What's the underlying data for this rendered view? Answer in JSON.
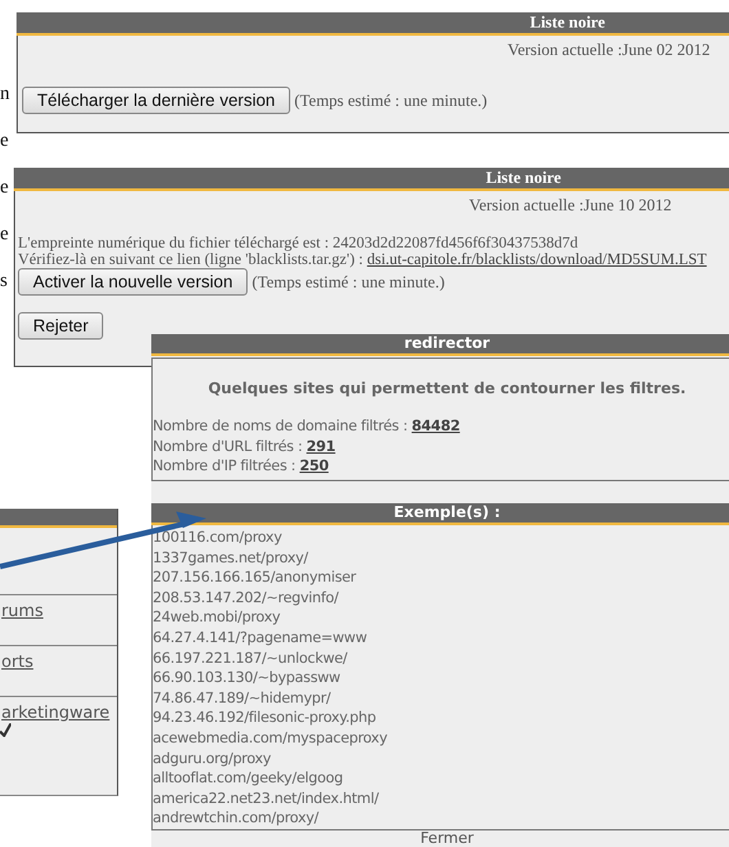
{
  "background_letters": [
    "n",
    "e",
    "e",
    "e",
    "s"
  ],
  "blacklist_current": {
    "title": "Liste noire",
    "version": "Version actuelle :June 02 2012",
    "button": "Télécharger la dernière version",
    "note": "(Temps estimé : une minute.)"
  },
  "blacklist_update": {
    "title": "Liste noire",
    "version": "Version actuelle :June 10 2012",
    "checksum": "L'empreinte numérique du fichier téléchargé est : 24203d2d22087fd456f6f30437538d7d",
    "verify_text": "Vérifiez-là en suivant ce lien (ligne 'blacklists.tar.gz') : ",
    "verify_link": "dsi.ut-capitole.fr/blacklists/download/MD5SUM.LST",
    "activate_button": "Activer la nouvelle version",
    "note": "(Temps estimé : une minute.)",
    "reject_button": "Rejeter"
  },
  "redirector": {
    "title": "redirector",
    "heading": "Quelques sites qui permettent de contourner les filtres.",
    "stats": [
      {
        "label": "Nombre de noms de domaine filtrés : ",
        "value": "84482"
      },
      {
        "label": "Nombre d'URL filtrés : ",
        "value": "291"
      },
      {
        "label": "Nombre d'IP filtrées : ",
        "value": "250"
      }
    ],
    "examples_title": "Exemple(s) :",
    "examples": [
      "100116.com/proxy",
      "1337games.net/proxy/",
      "207.156.166.165/anonymiser",
      "208.53.147.202/~regvinfo/",
      "24web.mobi/proxy",
      "64.27.4.141/?pagename=www",
      "66.197.221.187/~unlockwe/",
      "66.90.103.130/~bypassww",
      "74.86.47.189/~hidemypr/",
      "94.23.46.192/filesonic-proxy.php",
      "acewebmedia.com/myspaceproxy",
      "adguru.org/proxy",
      "alltooflat.com/geeky/elgoog",
      "america22.net23.net/index.html/",
      "andrewtchin.com/proxy/"
    ],
    "close": "Fermer"
  },
  "category_list": {
    "rows": [
      {
        "name": "rums",
        "checked": false
      },
      {
        "name": "orts",
        "checked": false
      },
      {
        "name": "arketingware",
        "checked": true
      }
    ]
  }
}
